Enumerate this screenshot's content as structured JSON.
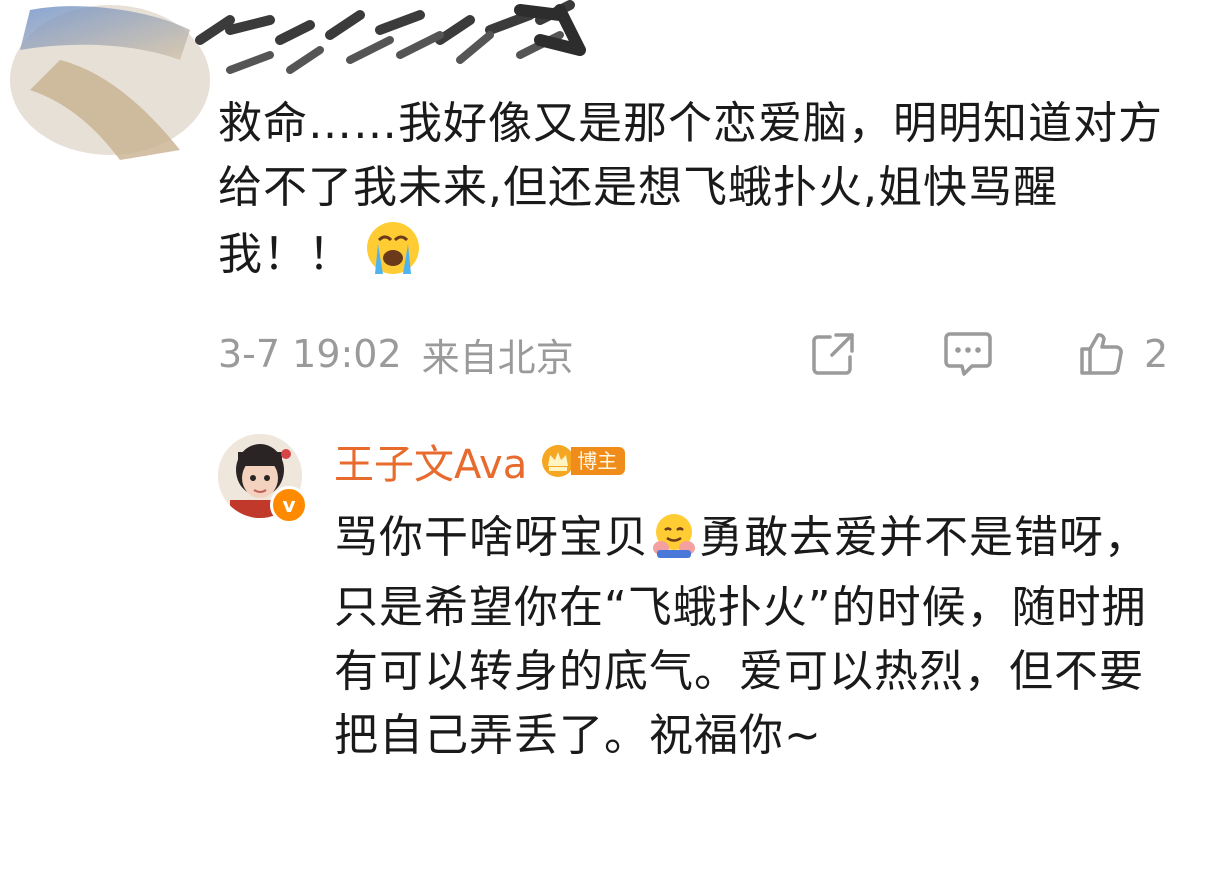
{
  "comment": {
    "text_part1": "救命……我好像又是那个恋爱脑，明明知道对方给不了我未来,但还是想飞蛾扑火,姐快骂醒我！！",
    "emoji": "loudly-crying-face",
    "time": "3-7 19:02",
    "location": "来自北京",
    "like_count": "2",
    "actions": {
      "share_icon": "share-icon",
      "comment_icon": "comment-icon",
      "like_icon": "thumbs-up-icon"
    }
  },
  "reply": {
    "username": "王子文Ava",
    "badge_label": "博主",
    "text_part1": "骂你干啥呀宝贝",
    "emoji": "hugging-face",
    "text_part2": "勇敢去爱并不是错呀，只是希望你在“飞蛾扑火”的时候，随时拥有可以转身的底气。爱可以热烈，但不要把自己弄丢了。祝福你~",
    "verified_mark": "v"
  },
  "colors": {
    "text": "#1a1a1a",
    "meta": "#9a9a9a",
    "username": "#e86b2e",
    "badge": "#f08c1a",
    "verified": "#ff8a00"
  }
}
